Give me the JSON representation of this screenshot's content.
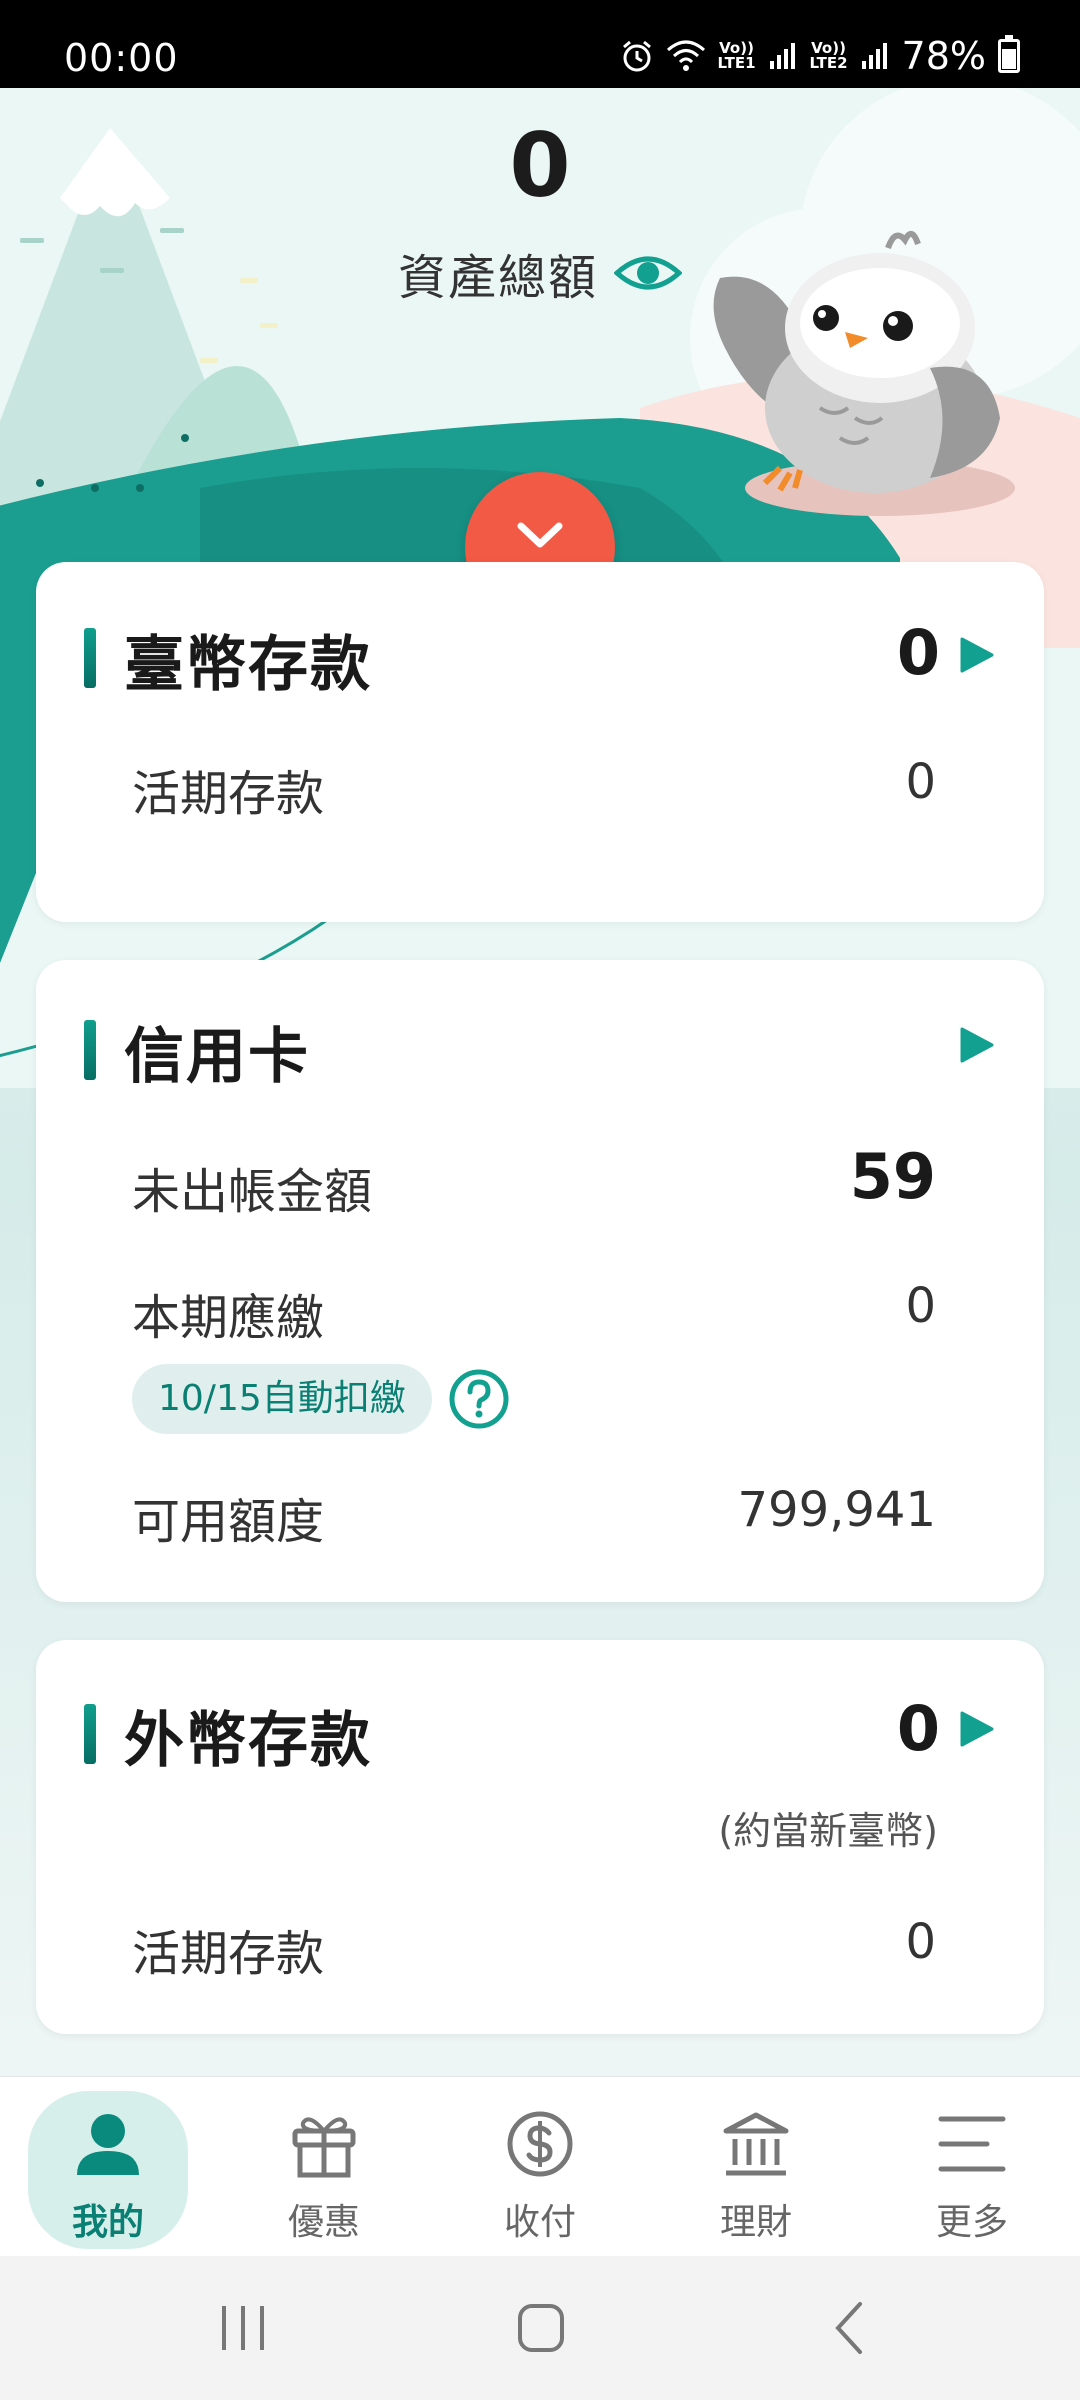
{
  "status_bar": {
    "time": "00:00",
    "network1": "Vo)) LTE1",
    "network2": "Vo)) LTE2",
    "battery": "78%"
  },
  "summary": {
    "total": "0",
    "label": "資產總額"
  },
  "twd_deposit": {
    "title": "臺幣存款",
    "total": "0",
    "rows": [
      {
        "label": "活期存款",
        "value": "0"
      }
    ]
  },
  "credit_card": {
    "title": "信用卡",
    "unbilled_label": "未出帳金額",
    "unbilled_value": "59",
    "due_label": "本期應繳",
    "due_value": "0",
    "autopay_badge": "10/15自動扣繳",
    "available_label": "可用額度",
    "available_value": "799,941"
  },
  "fx_deposit": {
    "title": "外幣存款",
    "total": "0",
    "note": "(約當新臺幣)",
    "rows": [
      {
        "label": "活期存款",
        "value": "0"
      }
    ]
  },
  "bottom_nav": {
    "items": [
      {
        "label": "我的",
        "icon": "person-icon",
        "active": true
      },
      {
        "label": "優惠",
        "icon": "gift-icon",
        "active": false
      },
      {
        "label": "收付",
        "icon": "dollar-circle-icon",
        "active": false
      },
      {
        "label": "理財",
        "icon": "bank-icon",
        "active": false
      },
      {
        "label": "更多",
        "icon": "menu-icon",
        "active": false
      }
    ]
  },
  "colors": {
    "accent": "#0f9e8d",
    "expand_button": "#f25a45",
    "badge_bg": "#e0efee"
  }
}
